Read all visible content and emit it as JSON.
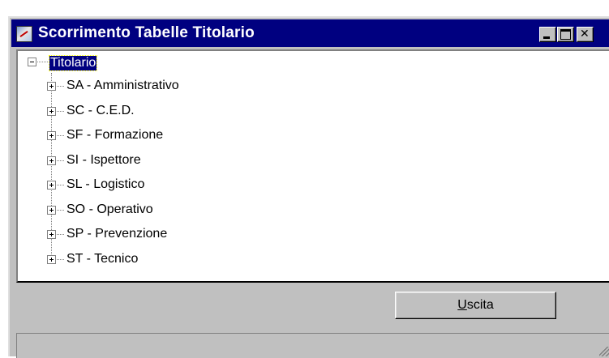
{
  "window": {
    "title": "Scorrimento Tabelle Titolario",
    "colors": {
      "titlebar": "#000080",
      "face": "#c0c0c0",
      "selection": "#000080"
    }
  },
  "tree": {
    "root": {
      "label": "Titolario",
      "expanded": true,
      "selected": true
    },
    "items": [
      {
        "label": "SA - Amministrativo"
      },
      {
        "label": "SC - C.E.D."
      },
      {
        "label": "SF - Formazione"
      },
      {
        "label": "SI - Ispettore"
      },
      {
        "label": "SL - Logistico"
      },
      {
        "label": "SO - Operativo"
      },
      {
        "label": "SP - Prevenzione"
      },
      {
        "label": "ST - Tecnico"
      }
    ]
  },
  "footer": {
    "exit_button": {
      "mnemonic": "U",
      "rest": "scita"
    }
  },
  "icons": [
    "app-icon",
    "minimize-icon",
    "maximize-icon",
    "close-icon",
    "collapse-icon",
    "expand-icon",
    "resize-grip-icon"
  ]
}
